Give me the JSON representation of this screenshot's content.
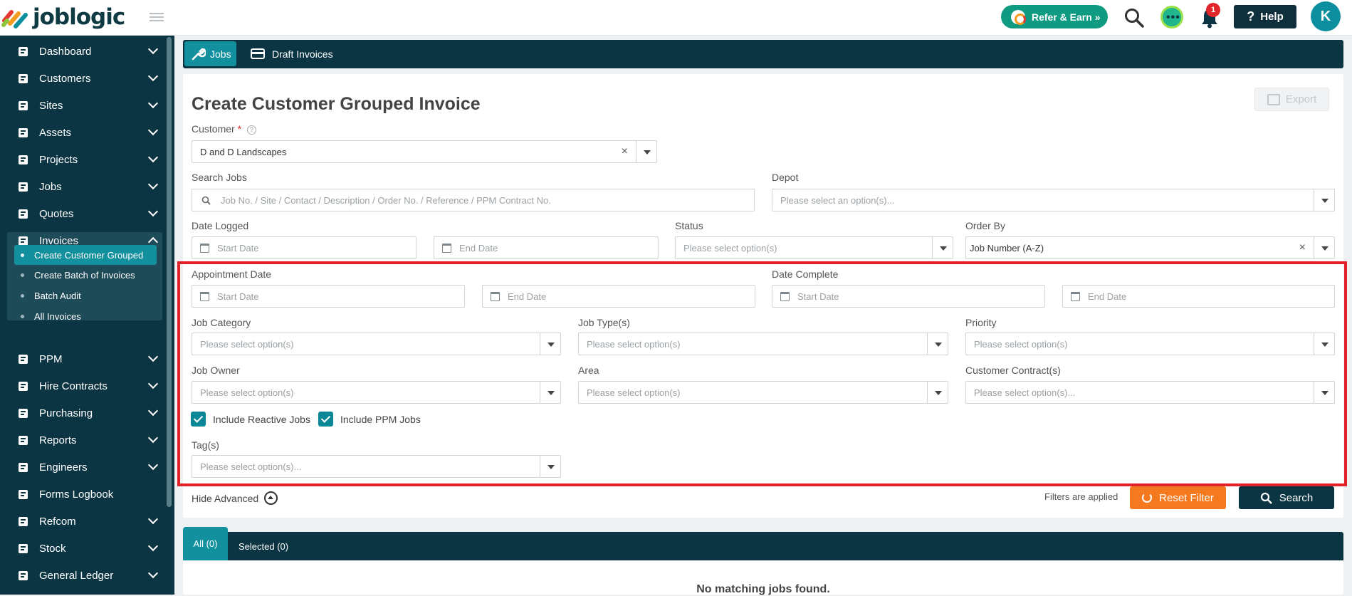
{
  "app": {
    "logo_text": "joblogic"
  },
  "topbar": {
    "refer_label": "Refer & Earn »",
    "notification_count": "1",
    "help_label": "Help",
    "avatar_initial": "K"
  },
  "sidebar": {
    "items": [
      {
        "label": "Dashboard",
        "icon": "dashboard-icon"
      },
      {
        "label": "Customers",
        "icon": "user-icon"
      },
      {
        "label": "Sites",
        "icon": "building-icon"
      },
      {
        "label": "Assets",
        "icon": "asset-icon"
      },
      {
        "label": "Projects",
        "icon": "projects-icon"
      },
      {
        "label": "Jobs",
        "icon": "wrench-icon"
      },
      {
        "label": "Quotes",
        "icon": "clipboard-icon"
      },
      {
        "label": "Invoices",
        "icon": "invoice-icon"
      },
      {
        "label": "PPM",
        "icon": "calendar-icon"
      },
      {
        "label": "Hire Contracts",
        "icon": "contract-icon"
      },
      {
        "label": "Purchasing",
        "icon": "purchasing-icon"
      },
      {
        "label": "Reports",
        "icon": "pie-chart-icon"
      },
      {
        "label": "Engineers",
        "icon": "engineers-icon"
      },
      {
        "label": "Forms Logbook",
        "icon": "book-icon"
      },
      {
        "label": "Refcom",
        "icon": "refcom-icon"
      },
      {
        "label": "Stock",
        "icon": "stock-icon"
      },
      {
        "label": "General Ledger",
        "icon": "ledger-icon"
      }
    ],
    "invoice_sub": [
      "Create Customer Grouped",
      "Create Batch of Invoices",
      "Batch Audit",
      "All Invoices"
    ]
  },
  "tabs": {
    "jobs": "Jobs",
    "draft_invoices": "Draft Invoices"
  },
  "form": {
    "title": "Create Customer Grouped Invoice",
    "export_label": "Export",
    "customer_label": "Customer",
    "customer_required": "*",
    "customer_value": "D and D Landscapes",
    "search_jobs_label": "Search Jobs",
    "search_jobs_placeholder": "Job No. / Site / Contact / Description / Order No. / Reference / PPM Contract No.",
    "depot_label": "Depot",
    "depot_placeholder": "Please select an option(s)...",
    "date_logged_label": "Date Logged",
    "start_date": "Start Date",
    "end_date": "End Date",
    "status_label": "Status",
    "status_placeholder": "Please select option(s)",
    "order_by_label": "Order By",
    "order_by_value": "Job Number (A-Z)",
    "appointment_date_label": "Appointment Date",
    "date_complete_label": "Date Complete",
    "job_category_label": "Job Category",
    "job_types_label": "Job Type(s)",
    "priority_label": "Priority",
    "job_owner_label": "Job Owner",
    "area_label": "Area",
    "customer_contracts_label": "Customer Contract(s)",
    "select_placeholder": "Please select option(s)",
    "select_placeholder_dots": "Please select option(s)...",
    "include_reactive": "Include Reactive Jobs",
    "include_ppm": "Include PPM Jobs",
    "tags_label": "Tag(s)",
    "hide_advanced": "Hide Advanced",
    "filters_applied": "Filters are applied",
    "reset_filter": "Reset Filter",
    "search_button": "Search"
  },
  "results": {
    "tab_all": "All (0)",
    "tab_selected": "Selected (0)",
    "empty_message": "No matching jobs found."
  },
  "colors": {
    "brand": "#0c3543",
    "accent": "#13909e",
    "reset": "#f57a1f",
    "highlight": "#e02127"
  }
}
